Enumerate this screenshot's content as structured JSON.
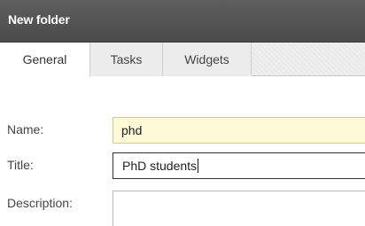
{
  "window": {
    "title": "New folder"
  },
  "tabs": [
    {
      "label": "General",
      "active": true
    },
    {
      "label": "Tasks",
      "active": false
    },
    {
      "label": "Widgets",
      "active": false
    }
  ],
  "form": {
    "name": {
      "label": "Name:",
      "value": "phd"
    },
    "title": {
      "label": "Title:",
      "value": "PhD students"
    },
    "description": {
      "label": "Description:",
      "value": ""
    }
  },
  "colors": {
    "titlebar": "#4f4f4f",
    "name_field_bg": "#fdf8d6",
    "tab_active_bg": "#ffffff"
  }
}
